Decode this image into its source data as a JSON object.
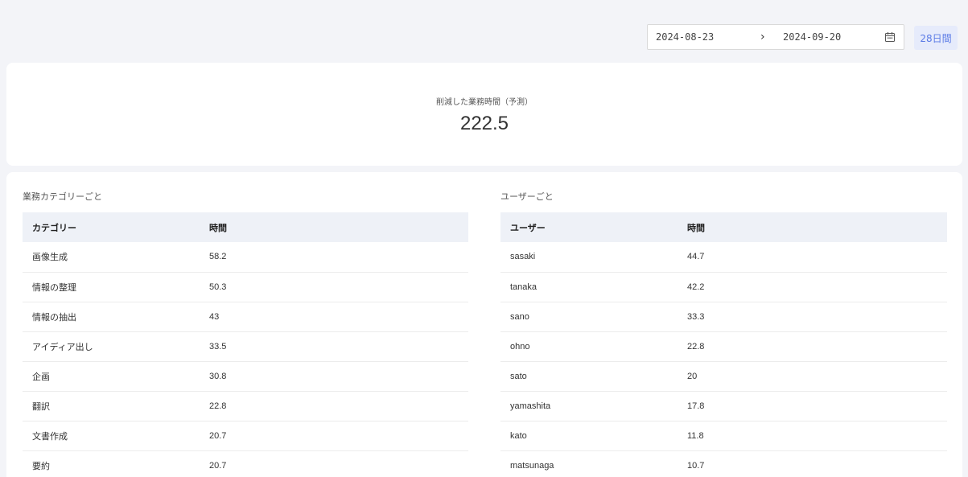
{
  "date_range": {
    "start": "2024-08-23",
    "arrow": "›",
    "end": "2024-09-20"
  },
  "period_badge": "28日間",
  "summary": {
    "label": "削減した業務時間（予測）",
    "value": "222.5"
  },
  "category_section": {
    "title": "業務カテゴリーごと",
    "headers": [
      "カテゴリー",
      "時間"
    ],
    "rows": [
      {
        "name": "画像生成",
        "time": "58.2"
      },
      {
        "name": "情報の整理",
        "time": "50.3"
      },
      {
        "name": "情報の抽出",
        "time": "43"
      },
      {
        "name": "アイディア出し",
        "time": "33.5"
      },
      {
        "name": "企画",
        "time": "30.8"
      },
      {
        "name": "翻訳",
        "time": "22.8"
      },
      {
        "name": "文書作成",
        "time": "20.7"
      },
      {
        "name": "要約",
        "time": "20.7"
      }
    ]
  },
  "user_section": {
    "title": "ユーザーごと",
    "headers": [
      "ユーザー",
      "時間"
    ],
    "rows": [
      {
        "name": "sasaki",
        "time": "44.7"
      },
      {
        "name": "tanaka",
        "time": "42.2"
      },
      {
        "name": "sano",
        "time": "33.3"
      },
      {
        "name": "ohno",
        "time": "22.8"
      },
      {
        "name": "sato",
        "time": "20"
      },
      {
        "name": "yamashita",
        "time": "17.8"
      },
      {
        "name": "kato",
        "time": "11.8"
      },
      {
        "name": "matsunaga",
        "time": "10.7"
      }
    ]
  },
  "colors": {
    "accent": "#5b7be6",
    "badge_bg": "#e6ebfb",
    "header_bg": "#eef1f7",
    "page_bg": "#f3f4f8"
  },
  "icons": {
    "calendar": "calendar-icon",
    "arrow": "chevron-right-icon"
  }
}
